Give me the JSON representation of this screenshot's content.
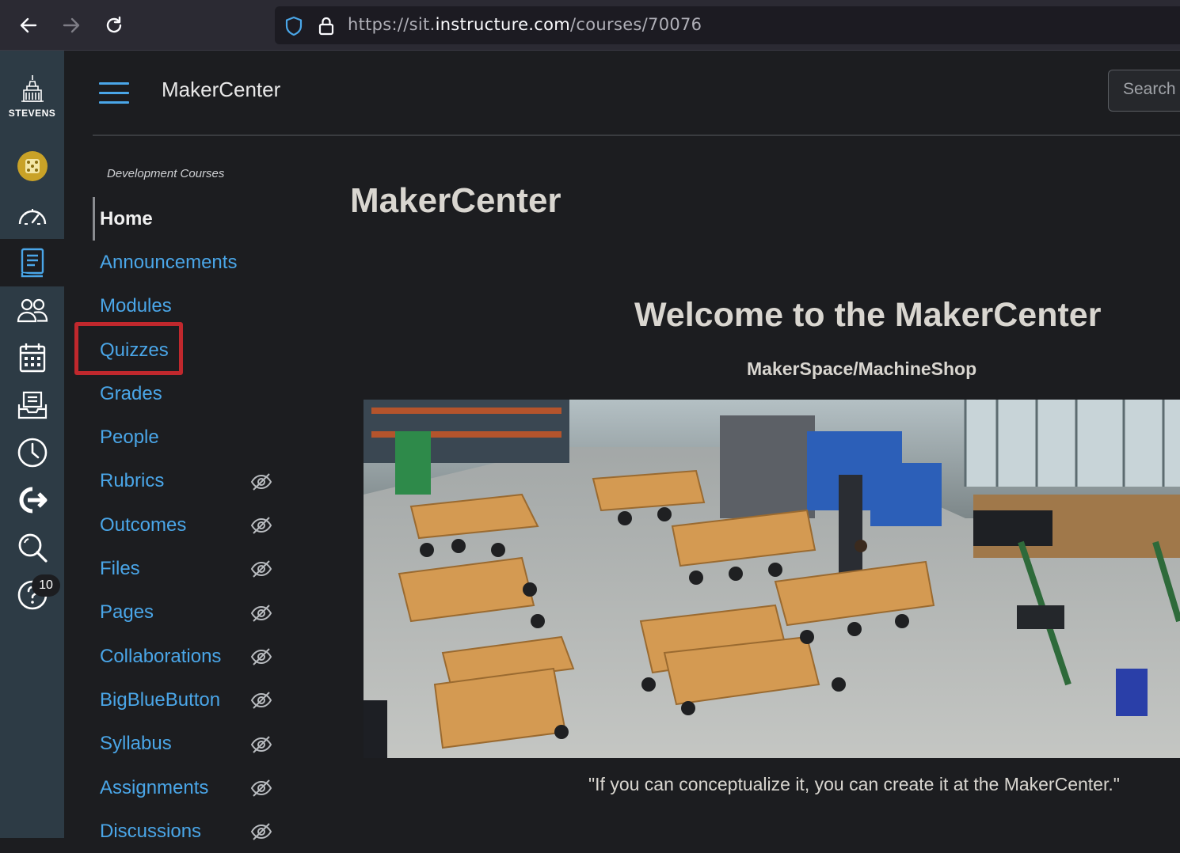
{
  "browser": {
    "url_prefix": "https://sit.",
    "url_host": "instructure.com",
    "url_path": "/courses/70076"
  },
  "global_nav": {
    "logo_text": "STEVENS",
    "items": [
      "account",
      "dashboard",
      "courses",
      "groups",
      "calendar",
      "inbox",
      "history",
      "commons",
      "search",
      "help"
    ],
    "help_badge": "10"
  },
  "header": {
    "breadcrumb": "MakerCenter",
    "search_placeholder": "Search t"
  },
  "course_nav": {
    "term": "Development Courses",
    "items": [
      {
        "label": "Home",
        "hidden": false
      },
      {
        "label": "Announcements",
        "hidden": false
      },
      {
        "label": "Modules",
        "hidden": false
      },
      {
        "label": "Quizzes",
        "hidden": false
      },
      {
        "label": "Grades",
        "hidden": false
      },
      {
        "label": "People",
        "hidden": false
      },
      {
        "label": "Rubrics",
        "hidden": true
      },
      {
        "label": "Outcomes",
        "hidden": true
      },
      {
        "label": "Files",
        "hidden": true
      },
      {
        "label": "Pages",
        "hidden": true
      },
      {
        "label": "Collaborations",
        "hidden": true
      },
      {
        "label": "BigBlueButton",
        "hidden": true
      },
      {
        "label": "Syllabus",
        "hidden": true
      },
      {
        "label": "Assignments",
        "hidden": true
      },
      {
        "label": "Discussions",
        "hidden": true
      }
    ]
  },
  "content": {
    "page_title": "MakerCenter",
    "welcome": "Welcome to the MakerCenter",
    "subtitle": "MakerSpace/MachineShop",
    "quote": "\"If you can conceptualize it, you can create it at the MakerCenter.\""
  },
  "colors": {
    "link": "#4aa6e8",
    "highlight": "#c0282d",
    "global_nav_bg": "#2d3b45"
  }
}
